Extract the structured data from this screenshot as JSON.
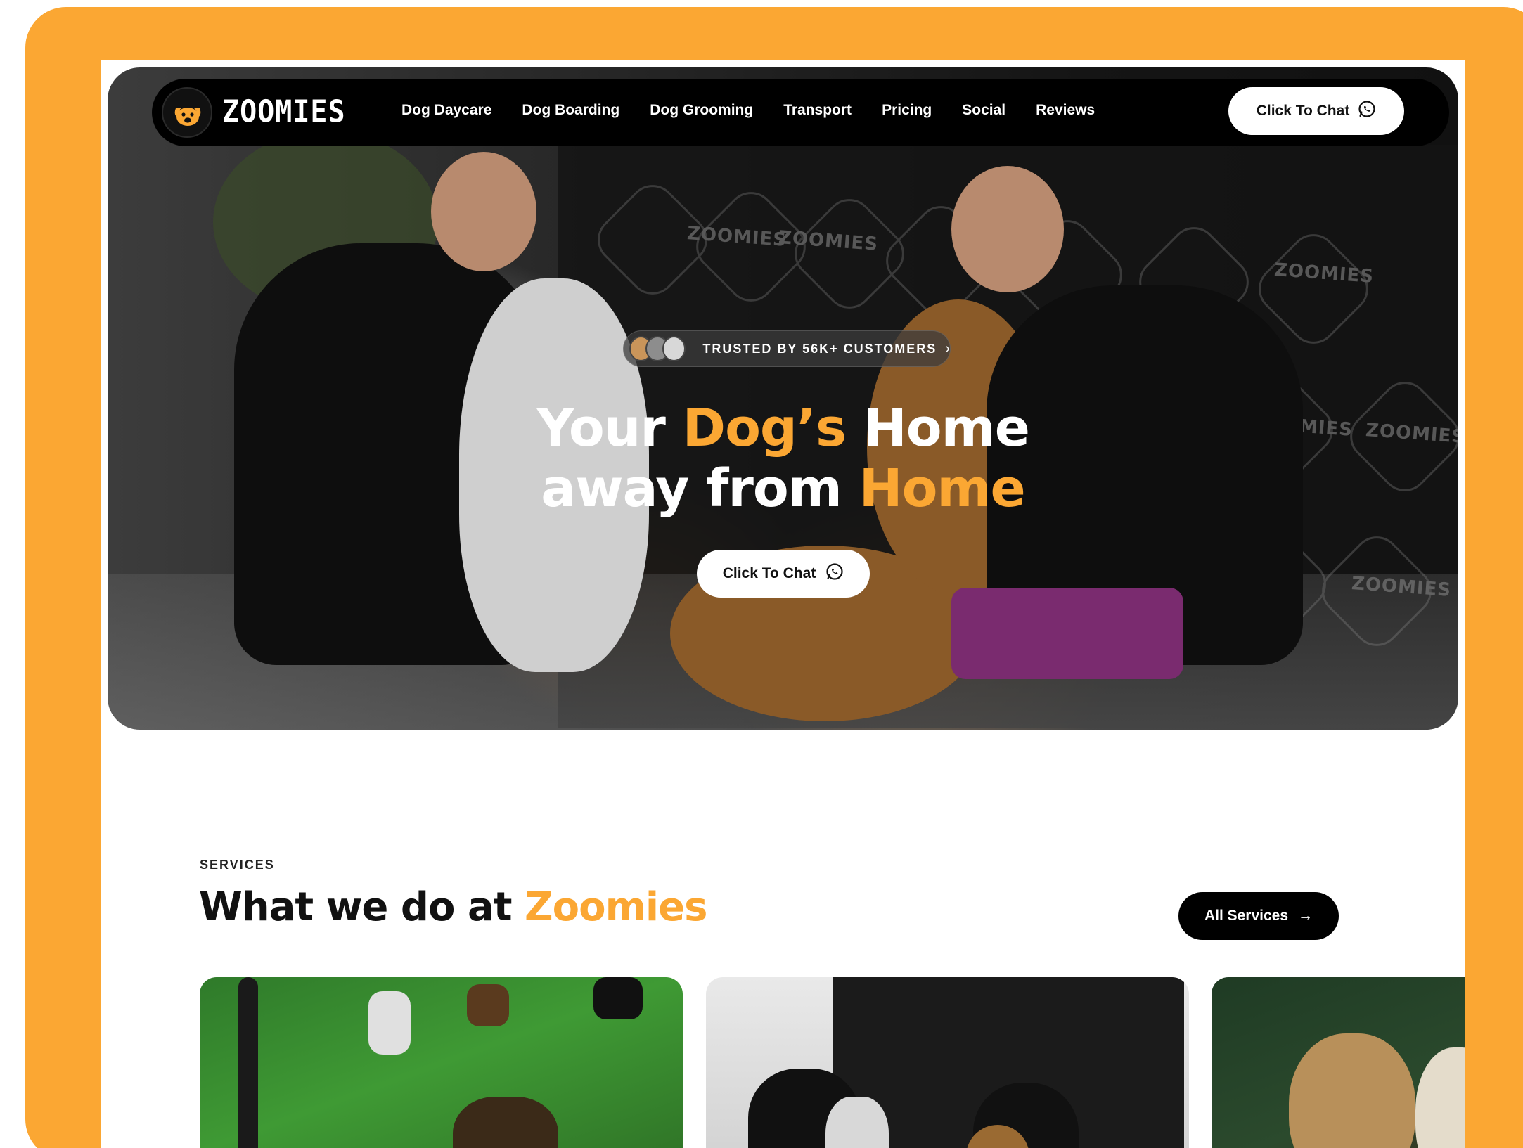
{
  "brand": {
    "name": "ZOOMIES",
    "accent_color": "#FBA733",
    "frame_color": "#FBA733"
  },
  "nav": {
    "links": [
      "Dog Daycare",
      "Dog Boarding",
      "Dog Grooming",
      "Transport",
      "Pricing",
      "Social",
      "Reviews"
    ],
    "cta_label": "Click To Chat",
    "cta_icon": "whatsapp-icon"
  },
  "hero": {
    "trust_badge": "TRUSTED BY 56K+ CUSTOMERS",
    "trust_chevron": "›",
    "headline_line1_a": "Your ",
    "headline_line1_accent": "Dog’s",
    "headline_line1_b": " Home",
    "headline_line2_a": "away from ",
    "headline_line2_accent": "Home",
    "cta_label": "Click To Chat",
    "wall_logo_text": "ZOOMIES"
  },
  "services": {
    "eyebrow": "SERVICES",
    "title_a": "What we do at ",
    "title_accent": "Zoomies",
    "all_services_label": "All Services",
    "all_services_arrow": "→"
  }
}
